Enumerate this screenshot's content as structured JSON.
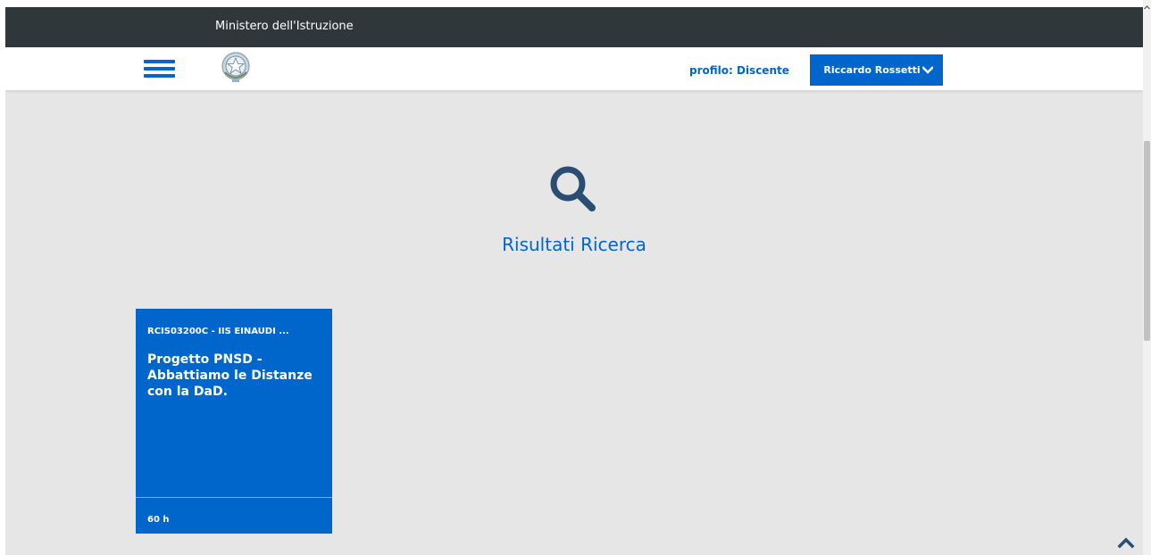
{
  "top_bar": {
    "ministry_name": "Ministero dell'Istruzione"
  },
  "header": {
    "menu_icon": "hamburger-menu-icon",
    "emblem_icon": "italian-republic-emblem-icon",
    "profile_label": "profilo: Discente",
    "user_name": "Riccardo Rossetti",
    "user_menu_icon": "chevron-down-icon"
  },
  "main": {
    "hero_icon": "search-icon",
    "title": "Risultati Ricerca",
    "results": [
      {
        "school": "RCIS03200C - IIS EINAUDI ...",
        "title": "Progetto PNSD - Abbattiamo le Distanze con la DaD.",
        "hours": "60 h"
      }
    ]
  },
  "back_to_top_icon": "chevron-up-icon",
  "colors": {
    "primary": "#0066cc",
    "top_bar": "#30373b",
    "page_bg": "#e6e6e6",
    "header_bg": "#ffffff",
    "icon_dark_blue": "#2a4e72"
  }
}
